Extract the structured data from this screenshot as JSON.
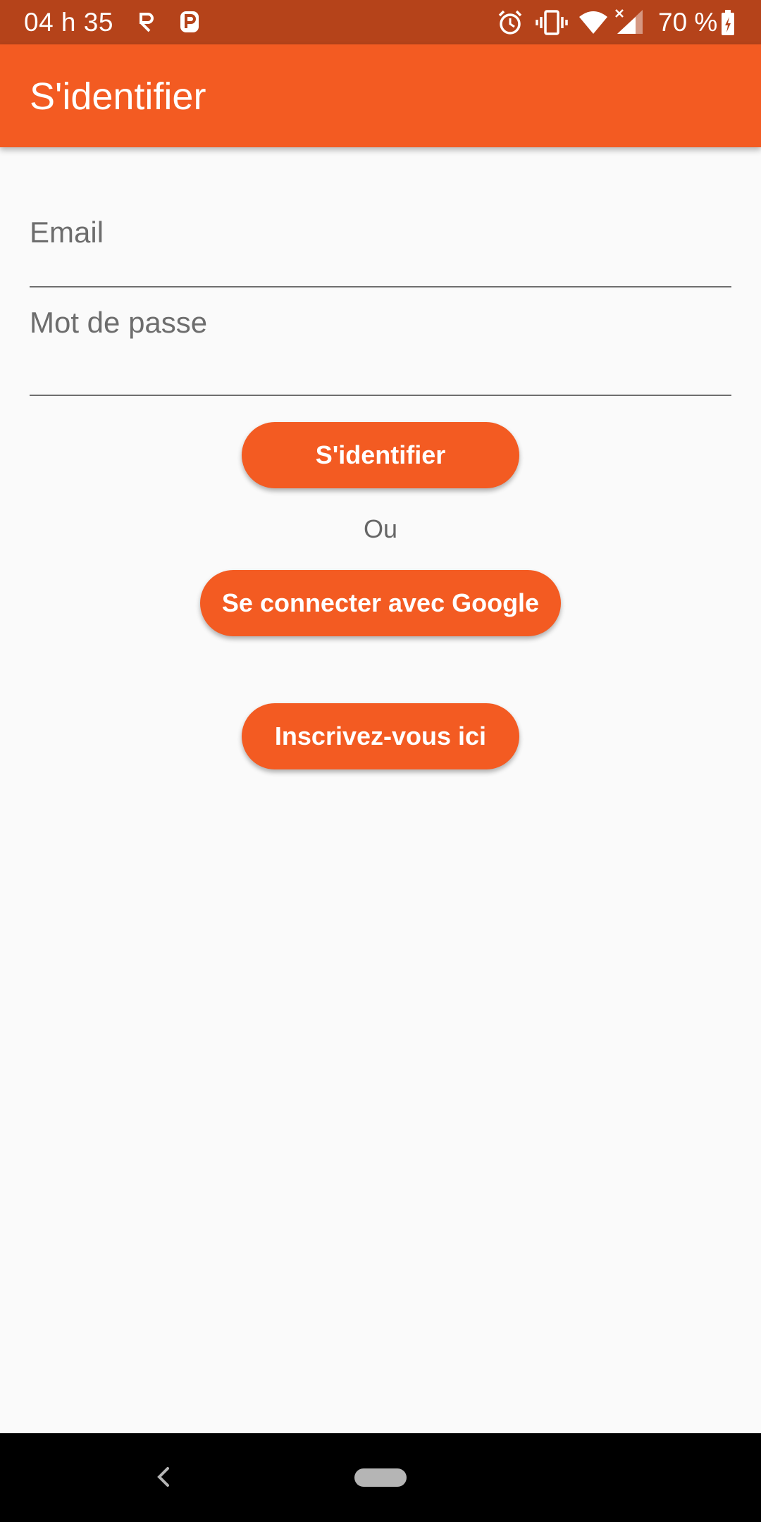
{
  "status_bar": {
    "time": "04 h 35",
    "battery_text": "70 %",
    "icons": [
      "rotate-icon",
      "parking-icon",
      "alarm-icon",
      "vibrate-icon",
      "wifi-icon",
      "signal-icon",
      "battery-charging-icon"
    ],
    "background": "#B5431A"
  },
  "app_bar": {
    "title": "S'identifier",
    "background": "#F35B22"
  },
  "form": {
    "email_label": "Email",
    "email_value": "",
    "password_label": "Mot de passe",
    "password_value": ""
  },
  "buttons": {
    "login_label": "S'identifier",
    "or_label": "Ou",
    "google_label": "Se connecter avec Google",
    "register_label": "Inscrivez-vous ici"
  },
  "nav_bar": {
    "icons": [
      "back-icon",
      "home-pill-icon"
    ]
  },
  "colors": {
    "accent": "#F35B22",
    "background": "#FAFAFA"
  }
}
